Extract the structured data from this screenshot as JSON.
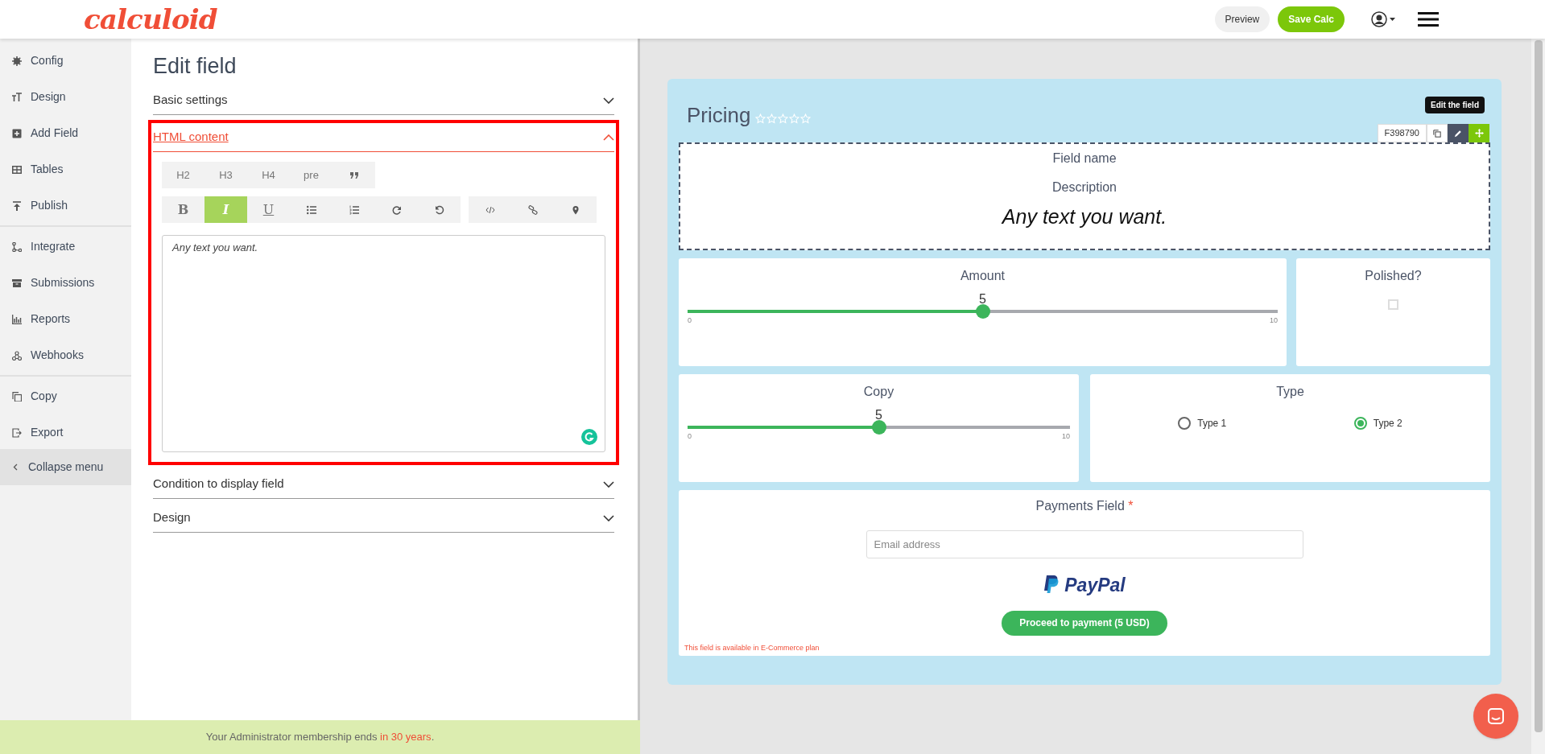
{
  "header": {
    "logo": "calculoid",
    "buttons": [
      {
        "label": "Preview",
        "kind": "secondary"
      },
      {
        "label": "Save Calc",
        "kind": "primary"
      }
    ]
  },
  "sidebar": {
    "groups": [
      [
        {
          "label": "Config",
          "kind": "gear"
        },
        {
          "label": "Design",
          "kind": "textsize"
        },
        {
          "label": "Add Field",
          "kind": "plus"
        },
        {
          "label": "Tables",
          "kind": "table"
        },
        {
          "label": "Publish",
          "kind": "upload"
        }
      ],
      [
        {
          "label": "Integrate",
          "kind": "branch"
        },
        {
          "label": "Submissions",
          "kind": "archive"
        },
        {
          "label": "Reports",
          "kind": "chart"
        },
        {
          "label": "Webhooks",
          "kind": "nodes"
        }
      ],
      [
        {
          "label": "Copy",
          "kind": "copy"
        },
        {
          "label": "Export",
          "kind": "export"
        }
      ]
    ],
    "collapse": {
      "label": "Collapse menu"
    }
  },
  "editor": {
    "title": "Edit field",
    "sections": [
      {
        "title": "Basic settings",
        "expanded": false
      },
      {
        "title": "HTML content",
        "expanded": true
      },
      {
        "title": "Condition to display field",
        "expanded": false
      },
      {
        "title": "Design",
        "expanded": false
      }
    ],
    "heading_toolbar": [
      {
        "kind": "text",
        "label": "H2"
      },
      {
        "kind": "text",
        "label": "H3"
      },
      {
        "kind": "text",
        "label": "H4"
      },
      {
        "kind": "text",
        "label": "pre"
      },
      {
        "kind": "quote"
      }
    ],
    "format_toolbar": [
      {
        "kind": "text",
        "label": "B",
        "selected": false
      },
      {
        "kind": "text",
        "label": "I",
        "selected": true
      },
      {
        "kind": "text",
        "label": "U",
        "selected": false
      },
      {
        "kind": "bullets",
        "selected": false
      },
      {
        "kind": "numbers",
        "selected": false
      },
      {
        "kind": "redo",
        "selected": false
      },
      {
        "kind": "undo",
        "selected": false
      }
    ],
    "insert_toolbar": [
      {
        "kind": "code"
      },
      {
        "kind": "link"
      },
      {
        "kind": "pin"
      }
    ],
    "content": "Any text you want."
  },
  "footer": {
    "text": "Your Administrator membership ends ",
    "highlight": "in 30 years",
    "end": "."
  },
  "preview": {
    "title": "Pricing",
    "rating": {
      "stars": 0
    },
    "tooltip": "Edit the field",
    "field_id": "F398790",
    "html_field": {
      "name": "Field name",
      "description": "Description",
      "content": "Any text you want."
    },
    "amount": {
      "label": "Amount",
      "reading": "5",
      "level": 0.5,
      "min": "0",
      "max": "10"
    },
    "polished": {
      "label": "Polished?",
      "checked": false
    },
    "copy": {
      "label": "Copy",
      "reading": "5",
      "level": 0.5,
      "min": "0",
      "max": "10"
    },
    "type": {
      "label": "Type",
      "options": [
        {
          "label": "Type 1",
          "selected": false
        },
        {
          "label": "Type 2",
          "selected": true
        }
      ]
    },
    "payments": {
      "label": "Payments Field",
      "required_mark": "*",
      "email_placeholder": "Email address",
      "paypal": "PayPal",
      "button": "Proceed to payment (5 USD)",
      "note": "This field is available in E-Commerce plan"
    }
  }
}
